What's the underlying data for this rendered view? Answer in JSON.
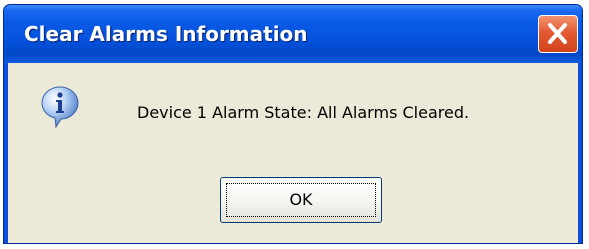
{
  "dialog": {
    "title": "Clear Alarms Information",
    "message": "Device 1 Alarm State: All Alarms Cleared.",
    "ok_label": "OK",
    "icon": "info-icon",
    "close_icon": "close-icon"
  },
  "colors": {
    "titlebar": "#0552dd",
    "close_button": "#e35a33",
    "client_background": "#ece9d8"
  }
}
